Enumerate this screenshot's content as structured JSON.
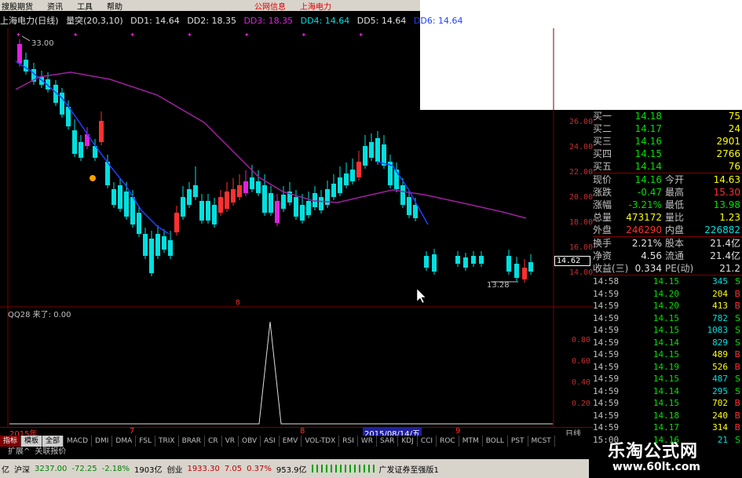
{
  "menu": {
    "items": [
      "搜股期货",
      "资讯",
      "工具",
      "帮助"
    ],
    "center_items": [
      "公网信息",
      "上海电力"
    ]
  },
  "info": {
    "title": "上海电力(日线)",
    "indicator": "量突(20,3,10)",
    "dd1": "DD1: 14.64",
    "dd2": "DD2: 18.35",
    "dd3": "DD3: 18.35",
    "dd4": "DD4: 14.64",
    "dd5": "DD5: 14.64",
    "dd6": "DD6: 14.64"
  },
  "price_axis": [
    "26.00",
    "24.00",
    "22.00",
    "20.00",
    "18.00",
    "16.00",
    "14.00"
  ],
  "price_marker": "14.62",
  "high_label": "33.00",
  "low_label": "13.28",
  "sub_header": "QQ28  来了: 0.00",
  "sub_axis": [
    "0.80",
    "0.60",
    "0.40",
    "0.20"
  ],
  "date_axis": {
    "year": "2015年",
    "m7": "7",
    "m8": "8",
    "m9": "9",
    "selected": "2015/08/14/五",
    "period": "日线"
  },
  "tabs": [
    "指标",
    "模板",
    "全部",
    "MACD",
    "DMI",
    "DMA",
    "FSL",
    "TRIX",
    "BRAR",
    "CR",
    "VR",
    "OBV",
    "ASI",
    "EMV",
    "VOL-TDX",
    "RSI",
    "WR",
    "SAR",
    "KDJ",
    "CCI",
    "ROC",
    "MTM",
    "BOLL",
    "PST",
    "MCST"
  ],
  "subtabs": [
    "扩展^",
    "关联报价"
  ],
  "status": {
    "index_name": "沪深",
    "index_value": "3237.00",
    "change": "-72.25",
    "pct": "-2.18%",
    "volume": "1903亿",
    "gem_name": "创业",
    "gem_value": "1933.30",
    "gem_change": "7.05",
    "gem_pct": "0.37%",
    "gem_volume": "953.9亿",
    "broker": "广发证券至强版1",
    "prefix": "亿"
  },
  "watermark": {
    "title": "乐淘公式网",
    "url": "www.60lt.com"
  },
  "order_book": [
    {
      "label": "买一",
      "price": "14.18",
      "vol": "75"
    },
    {
      "label": "买二",
      "price": "14.17",
      "vol": "24"
    },
    {
      "label": "买三",
      "price": "14.16",
      "vol": "2901"
    },
    {
      "label": "买四",
      "price": "14.15",
      "vol": "2766"
    },
    {
      "label": "买五",
      "price": "14.14",
      "vol": "76"
    }
  ],
  "quote": [
    {
      "l1": "现价",
      "v1": "14.16",
      "l2": "今开",
      "v2": "14.63"
    },
    {
      "l1": "涨跌",
      "v1": "-0.47",
      "l2": "最高",
      "v2": "15.30"
    },
    {
      "l1": "涨幅",
      "v1": "-3.21%",
      "l2": "最低",
      "v2": "13.98"
    },
    {
      "l1": "总量",
      "v1": "473172",
      "l2": "量比",
      "v2": "1.23"
    },
    {
      "l1": "外盘",
      "v1": "246290",
      "l2": "内盘",
      "v2": "226882"
    }
  ],
  "stats": [
    {
      "l1": "换手",
      "v1": "2.21%",
      "l2": "股本",
      "v2": "21.4亿"
    },
    {
      "l1": "净资",
      "v1": "4.56",
      "l2": "流通",
      "v2": "21.4亿"
    },
    {
      "l1": "收益(三)",
      "v1": "0.334",
      "l2": "PE(动)",
      "v2": "21.2"
    }
  ],
  "ticks": [
    {
      "t": "14:58",
      "p": "14.15",
      "v": "345",
      "bs": "S"
    },
    {
      "t": "14:59",
      "p": "14.20",
      "v": "204",
      "bs": "B"
    },
    {
      "t": "14:59",
      "p": "14.20",
      "v": "413",
      "bs": "B"
    },
    {
      "t": "14:59",
      "p": "14.15",
      "v": "782",
      "bs": "S"
    },
    {
      "t": "14:59",
      "p": "14.15",
      "v": "1083",
      "bs": "S"
    },
    {
      "t": "14:59",
      "p": "14.14",
      "v": "829",
      "bs": "S"
    },
    {
      "t": "14:59",
      "p": "14.15",
      "v": "489",
      "bs": "B"
    },
    {
      "t": "14:59",
      "p": "14.19",
      "v": "526",
      "bs": "B"
    },
    {
      "t": "14:59",
      "p": "14.15",
      "v": "487",
      "bs": "S"
    },
    {
      "t": "14:59",
      "p": "14.14",
      "v": "295",
      "bs": "S"
    },
    {
      "t": "14:59",
      "p": "14.15",
      "v": "702",
      "bs": "B"
    },
    {
      "t": "14:59",
      "p": "14.18",
      "v": "240",
      "bs": "B"
    },
    {
      "t": "14:59",
      "p": "14.17",
      "v": "314",
      "bs": "B"
    },
    {
      "t": "15:00",
      "p": "14.16",
      "v": "21",
      "bs": "S"
    }
  ],
  "colors": {
    "up": "#ff3030",
    "down": "#00e0e0",
    "bull": "#e020e0",
    "ma": "#a020a0",
    "border": "#800000"
  }
}
